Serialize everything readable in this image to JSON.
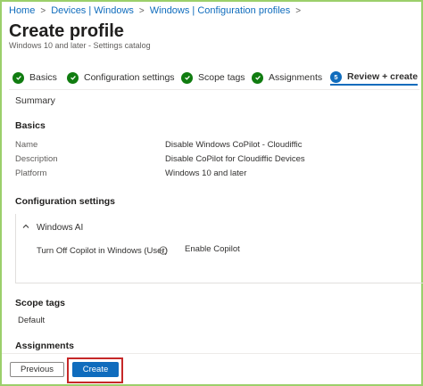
{
  "breadcrumb": [
    "Home",
    "Devices | Windows",
    "Windows | Configuration profiles"
  ],
  "page": {
    "title": "Create profile",
    "more": "···",
    "subtitle": "Windows 10 and later - Settings catalog"
  },
  "steps": [
    {
      "label": "Basics",
      "state": "done"
    },
    {
      "label": "Configuration settings",
      "state": "done"
    },
    {
      "label": "Scope tags",
      "state": "done"
    },
    {
      "label": "Assignments",
      "state": "done"
    },
    {
      "label": "Review + create",
      "state": "active",
      "number": "5"
    }
  ],
  "summary": {
    "label": "Summary"
  },
  "basics": {
    "heading": "Basics",
    "rows": [
      {
        "key": "Name",
        "value": "Disable Windows CoPilot - Cloudiffic"
      },
      {
        "key": "Description",
        "value": "Disable CoPilot for Cloudiffic Devices"
      },
      {
        "key": "Platform",
        "value": "Windows 10 and later"
      }
    ]
  },
  "config": {
    "heading": "Configuration settings",
    "group": "Windows AI",
    "setting_name": "Turn Off Copilot in Windows (User)",
    "setting_value": "Enable Copilot"
  },
  "scope": {
    "heading": "Scope tags",
    "value": "Default"
  },
  "assignments": {
    "heading": "Assignments"
  },
  "footer": {
    "previous": "Previous",
    "create": "Create"
  },
  "colors": {
    "accent": "#0f6cbd",
    "success": "#107c10",
    "highlight": "#c62828",
    "frame": "#9bcf6b"
  }
}
